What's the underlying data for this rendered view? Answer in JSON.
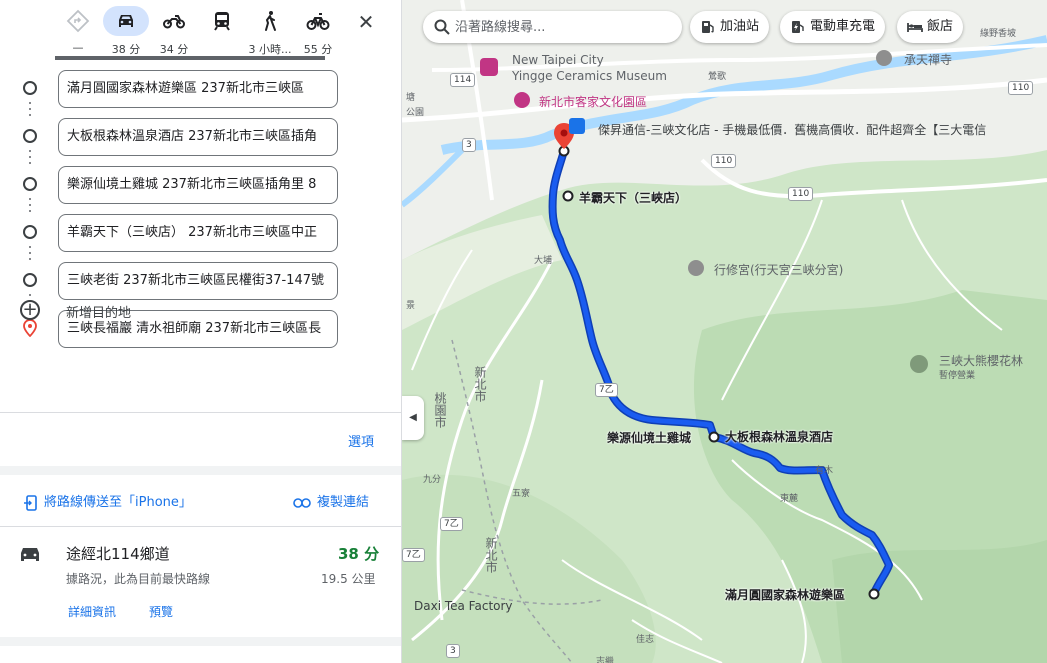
{
  "travel_modes": [
    {
      "name": "best",
      "time": "—"
    },
    {
      "name": "car",
      "time": "38 分"
    },
    {
      "name": "motorcycle",
      "time": "34 分"
    },
    {
      "name": "transit",
      "time": ""
    },
    {
      "name": "walk",
      "time": "3 小時..."
    },
    {
      "name": "bicycle",
      "time": "55 分"
    }
  ],
  "close_label": "✕",
  "stops": [
    "滿月圓國家森林遊樂區 237新北市三峽區",
    "大板根森林溫泉酒店 237新北市三峽區插角",
    "樂源仙境土雞城 237新北市三峽區插角里 8",
    "羊霸天下（三峽店） 237新北市三峽區中正",
    "三峽老街 237新北市三峽區民權街37-147號",
    "三峽長福巖 清水祖師廟 237新北市三峽區長"
  ],
  "add_destination": "新增目的地",
  "options": "選項",
  "send_to_phone": "將路線傳送至「iPhone」",
  "copy_link": "複製連結",
  "route": {
    "title": "途經北114鄉道",
    "time": "38 分",
    "description": "據路況，此為目前最快路線",
    "distance": "19.5 公里",
    "details": "詳細資訊",
    "preview": "預覽"
  },
  "map": {
    "search_placeholder": "沿著路線搜尋...",
    "chips": [
      "加油站",
      "電動車充電",
      "飯店"
    ],
    "labels": {
      "museum_en1": "New Taipei City",
      "museum_en2": "Yingge Ceramics Museum",
      "hakka": "新北市客家文化園區",
      "store": "傑昇通信-三峽文化店 - 手機最低價．舊機高價收．配件超齊全【三大電信",
      "yangba": "羊霸天下（三峽店）",
      "xingxiu": "行修宮(行天宮三峽分宮)",
      "leyuan": "樂源仙境土雞城",
      "daban": "大板根森林溫泉酒店",
      "manyue": "滿月圓國家森林遊樂區",
      "sakura": "三峽大熊櫻花林",
      "sakura_sub": "暫停營業",
      "chengtian": "承天禪寺",
      "tea": "Daxi Tea Factory",
      "taoyuan": "桃園市",
      "newtaipei1": "新北市",
      "newtaipei2": "新北市",
      "dapu": "大埔",
      "jiufen": "九分",
      "wuqi": "五寮",
      "youmu": "有木",
      "donglu": "東麓",
      "jiadi": "佳志",
      "zhimei": "志繼",
      "luying": "綠野香坡",
      "yingge_hint": "鶯歌",
      "tang_hint": "塘",
      "gong_hint": "公園",
      "jing": "景"
    },
    "shields": [
      "114",
      "110",
      "110",
      "110",
      "3",
      "7乙",
      "7乙",
      "3",
      "7乙"
    ],
    "colors": {
      "route": "#1a5cf0",
      "route_outline": "#0f3fb5",
      "pin": "#ea4335"
    }
  }
}
